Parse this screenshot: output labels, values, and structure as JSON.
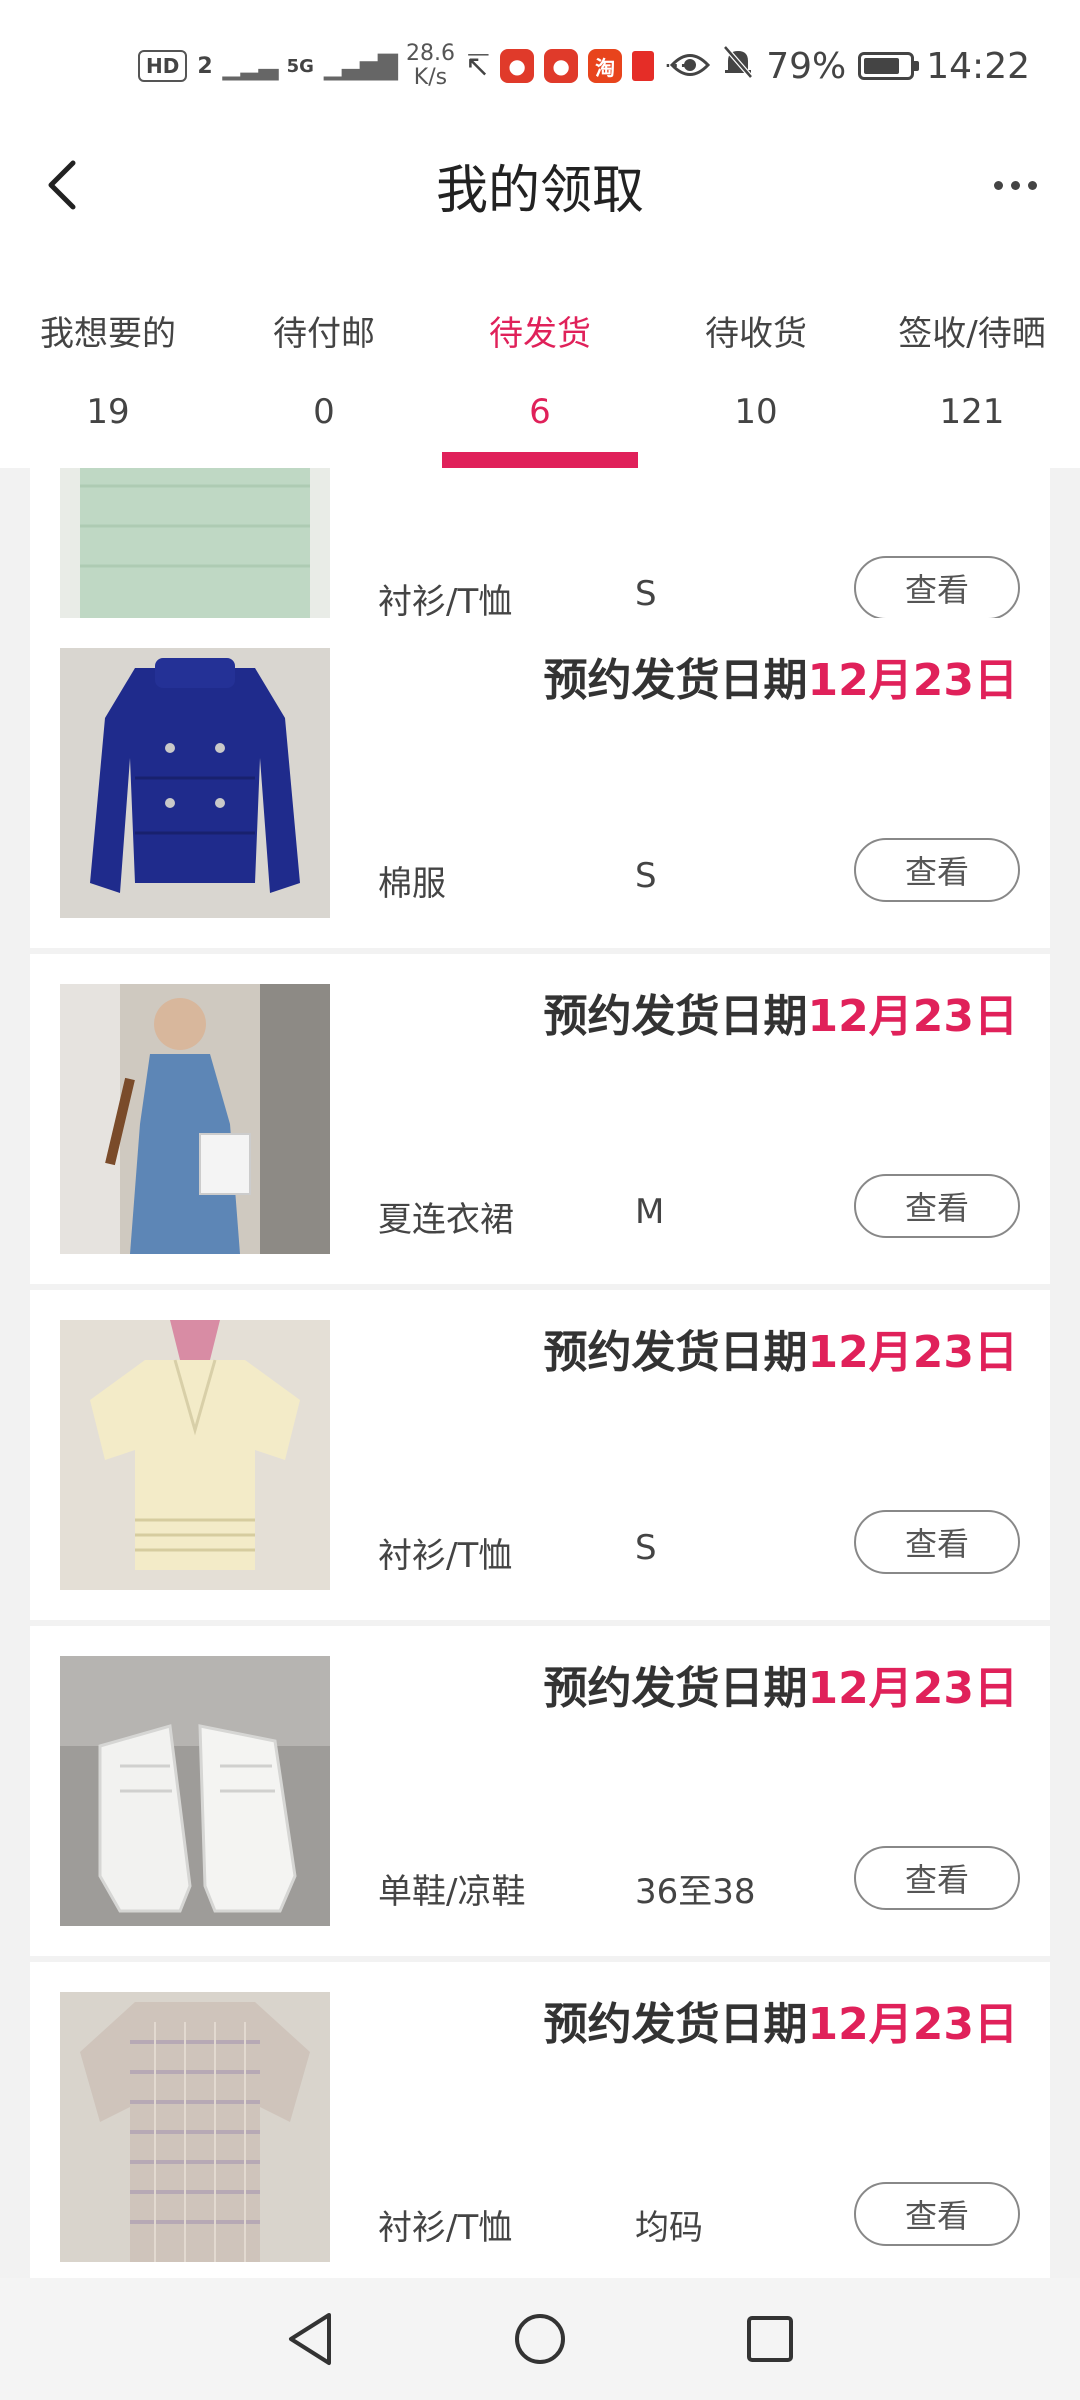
{
  "status_bar": {
    "hd": "HD",
    "sim2": "2",
    "net": "5G",
    "speed_value": "28.6",
    "speed_unit": "K/s",
    "taobao_icon_text": "淘",
    "overflow": "···",
    "battery_percent": "79%",
    "battery_level": 0.79,
    "time": "14:22"
  },
  "header": {
    "title": "我的领取"
  },
  "tabs": [
    {
      "label": "我想要的",
      "count": "19",
      "active": false
    },
    {
      "label": "待付邮",
      "count": "0",
      "active": false
    },
    {
      "label": "待发货",
      "count": "6",
      "active": true
    },
    {
      "label": "待收货",
      "count": "10",
      "active": false
    },
    {
      "label": "签收/待晒",
      "count": "121",
      "active": false
    }
  ],
  "items": [
    {
      "ship_prefix": "",
      "ship_date": "",
      "category": "衬衫/T恤",
      "size": "S",
      "view_label": "查看",
      "thumb": "mint-top"
    },
    {
      "ship_prefix": "预约发货日期",
      "ship_date": "12月23日",
      "category": "棉服",
      "size": "S",
      "view_label": "查看",
      "thumb": "blue-jacket"
    },
    {
      "ship_prefix": "预约发货日期",
      "ship_date": "12月23日",
      "category": "夏连衣裙",
      "size": "M",
      "view_label": "查看",
      "thumb": "denim-dress"
    },
    {
      "ship_prefix": "预约发货日期",
      "ship_date": "12月23日",
      "category": "衬衫/T恤",
      "size": "S",
      "view_label": "查看",
      "thumb": "cream-blouse"
    },
    {
      "ship_prefix": "预约发货日期",
      "ship_date": "12月23日",
      "category": "单鞋/凉鞋",
      "size": "36至38",
      "view_label": "查看",
      "thumb": "white-sneakers"
    },
    {
      "ship_prefix": "预约发货日期",
      "ship_date": "12月23日",
      "category": "衬衫/T恤",
      "size": "均码",
      "view_label": "查看",
      "thumb": "knit-top"
    }
  ],
  "colors": {
    "accent": "#e0215a",
    "text": "#333333",
    "background": "#f2f2f2"
  }
}
